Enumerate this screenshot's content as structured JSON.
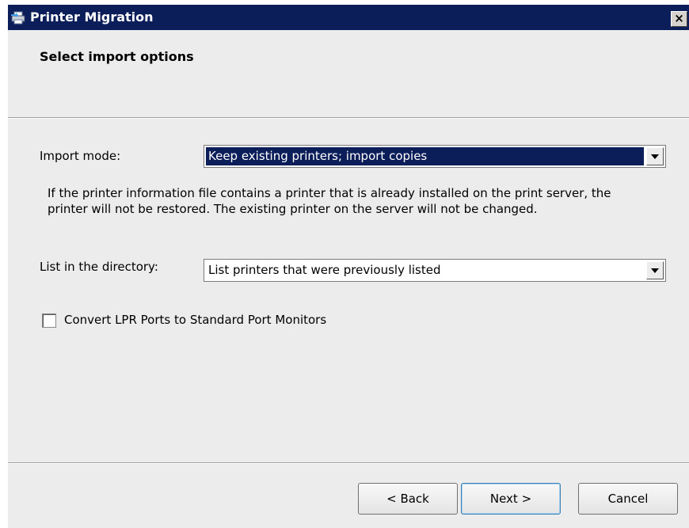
{
  "window": {
    "title": "Printer Migration",
    "close_glyph": "×"
  },
  "header": {
    "heading": "Select import options"
  },
  "import_mode": {
    "label": "Import mode:",
    "selected": "Keep existing printers; import copies",
    "description": "If the printer information file contains a printer that is already installed on the print server, the printer will not be restored. The existing printer on the server will not be changed."
  },
  "directory": {
    "label": "List in the directory:",
    "selected": "List printers that were previously listed"
  },
  "lpr_option": {
    "label": "Convert LPR Ports to Standard Port Monitors",
    "checked": false
  },
  "buttons": {
    "back": "< Back",
    "next": "Next >",
    "cancel": "Cancel"
  },
  "colors": {
    "titlebar": "#0c1e5a",
    "selection": "#0c1e5a",
    "dialog_bg": "#ececec"
  },
  "icons": {
    "app": "printer-icon",
    "close": "close-icon",
    "dropdown": "chevron-down-icon"
  }
}
